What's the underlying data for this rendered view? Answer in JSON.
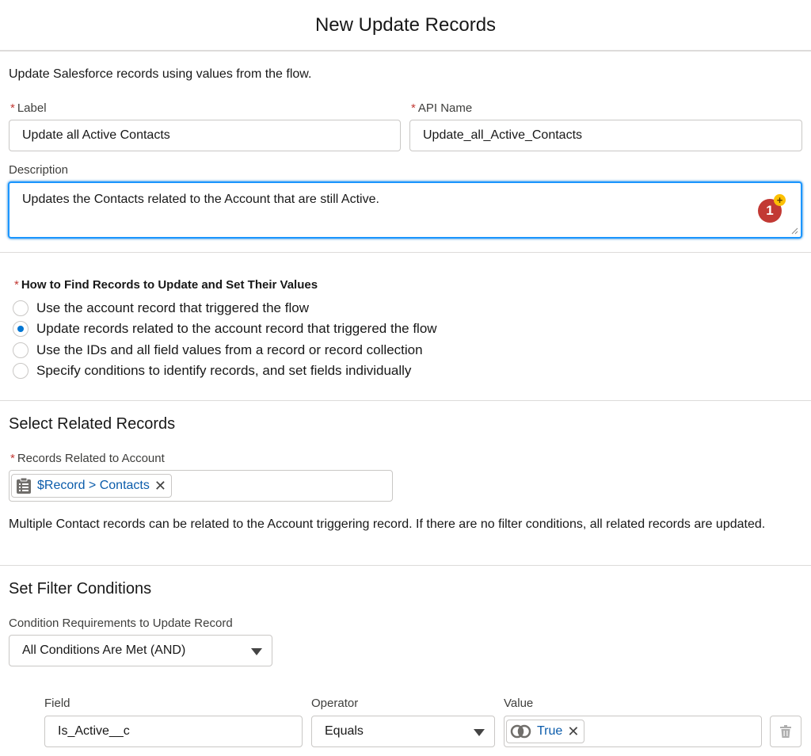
{
  "header": {
    "title": "New Update Records"
  },
  "intro": "Update Salesforce records using values from the flow.",
  "label_field": {
    "label": "Label",
    "value": "Update all Active Contacts"
  },
  "api_field": {
    "label": "API Name",
    "value": "Update_all_Active_Contacts"
  },
  "description_field": {
    "label": "Description",
    "value": "Updates the Contacts related to the Account that are still Active.",
    "badge_count": "1",
    "badge_plus": "+"
  },
  "find_records": {
    "label": "How to Find Records to Update and Set Their Values",
    "options": [
      {
        "label": "Use the account record that triggered the flow",
        "checked": false
      },
      {
        "label": "Update records related to the account record that triggered the flow",
        "checked": true
      },
      {
        "label": "Use the IDs and all field values from a record or record collection",
        "checked": false
      },
      {
        "label": "Specify conditions to identify records, and set fields individually",
        "checked": false
      }
    ]
  },
  "related": {
    "title": "Select Related Records",
    "field_label": "Records Related to Account",
    "pill": "$Record > Contacts",
    "help": "Multiple Contact records can be related to the Account triggering record. If there are no filter conditions, all related records are updated."
  },
  "filters": {
    "title": "Set Filter Conditions",
    "requirement_label": "Condition Requirements to Update Record",
    "requirement_value": "All Conditions Are Met (AND)",
    "columns": {
      "field": "Field",
      "operator": "Operator",
      "value": "Value"
    },
    "row": {
      "field": "Is_Active__c",
      "operator": "Equals",
      "value": "True"
    }
  },
  "colors": {
    "accent": "#0176d3",
    "required": "#c23934",
    "link": "#0b5cab",
    "badge": "#c23934",
    "badge_plus": "#fcc003"
  },
  "icons": [
    "record-list-icon",
    "close-icon",
    "boolean-icon",
    "trash-icon",
    "chevron-down-icon"
  ]
}
